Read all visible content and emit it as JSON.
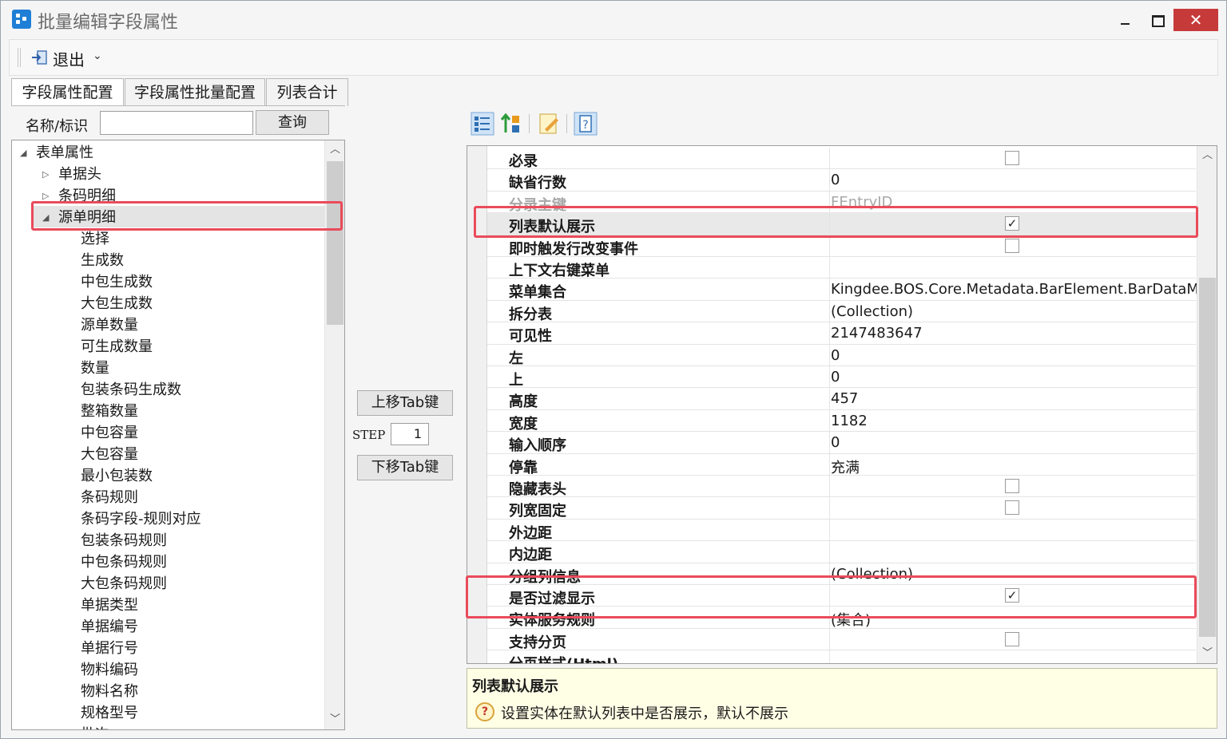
{
  "window": {
    "title": "批量编辑字段属性",
    "close_glyph": "✕"
  },
  "toolbar": {
    "exit_label": "退出",
    "dropdown_glyph": "⌄"
  },
  "tabs": [
    {
      "label": "字段属性配置",
      "active": true
    },
    {
      "label": "字段属性批量配置",
      "active": false
    },
    {
      "label": "列表合计",
      "active": false
    }
  ],
  "search": {
    "label": "名称/标识",
    "value": "",
    "button": "查询"
  },
  "tree": {
    "items": [
      {
        "label": "表单属性",
        "level": 0,
        "twisty": "◢"
      },
      {
        "label": "单据头",
        "level": 1,
        "twisty": "▷"
      },
      {
        "label": "条码明细",
        "level": 1,
        "twisty": "▷"
      },
      {
        "label": "源单明细",
        "level": 1,
        "twisty": "◢",
        "selected": true
      },
      {
        "label": "选择",
        "level": 2
      },
      {
        "label": "生成数",
        "level": 2
      },
      {
        "label": "中包生成数",
        "level": 2
      },
      {
        "label": "大包生成数",
        "level": 2
      },
      {
        "label": "源单数量",
        "level": 2
      },
      {
        "label": "可生成数量",
        "level": 2
      },
      {
        "label": "数量",
        "level": 2
      },
      {
        "label": "包装条码生成数",
        "level": 2
      },
      {
        "label": "整箱数量",
        "level": 2
      },
      {
        "label": "中包容量",
        "level": 2
      },
      {
        "label": "大包容量",
        "level": 2
      },
      {
        "label": "最小包装数",
        "level": 2
      },
      {
        "label": "条码规则",
        "level": 2
      },
      {
        "label": "条码字段-规则对应",
        "level": 2
      },
      {
        "label": "包装条码规则",
        "level": 2
      },
      {
        "label": "中包条码规则",
        "level": 2
      },
      {
        "label": "大包条码规则",
        "level": 2
      },
      {
        "label": "单据类型",
        "level": 2
      },
      {
        "label": "单据编号",
        "level": 2
      },
      {
        "label": "单据行号",
        "level": 2
      },
      {
        "label": "物料编码",
        "level": 2
      },
      {
        "label": "物料名称",
        "level": 2
      },
      {
        "label": "规格型号",
        "level": 2
      },
      {
        "label": "批次",
        "level": 2
      }
    ]
  },
  "middle": {
    "move_up": "上移Tab键",
    "step_label": "STEP",
    "step_value": "1",
    "move_down": "下移Tab键"
  },
  "property_grid": {
    "rows": [
      {
        "name": "必录",
        "type": "checkbox",
        "checked": false
      },
      {
        "name": "缺省行数",
        "value": "0"
      },
      {
        "name": "分录主键",
        "value": "FEntryID",
        "disabled": true
      },
      {
        "name": "列表默认展示",
        "type": "checkbox",
        "checked": true,
        "highlight": true
      },
      {
        "name": "即时触发行改变事件",
        "type": "checkbox",
        "checked": false
      },
      {
        "name": "上下文右键菜单",
        "value": ""
      },
      {
        "name": "菜单集合",
        "value": "Kingdee.BOS.Core.Metadata.BarElement.BarDataMa..."
      },
      {
        "name": "拆分表",
        "value": "(Collection)"
      },
      {
        "name": "可见性",
        "value": "2147483647"
      },
      {
        "name": "左",
        "value": "0"
      },
      {
        "name": "上",
        "value": "0"
      },
      {
        "name": "高度",
        "value": "457"
      },
      {
        "name": "宽度",
        "value": "1182"
      },
      {
        "name": "输入顺序",
        "value": "0"
      },
      {
        "name": "停靠",
        "value": "充满"
      },
      {
        "name": "隐藏表头",
        "type": "checkbox",
        "checked": false
      },
      {
        "name": "列宽固定",
        "type": "checkbox",
        "checked": false
      },
      {
        "name": "外边距",
        "value": ""
      },
      {
        "name": "内边距",
        "value": ""
      },
      {
        "name": "分组列信息",
        "value": "(Collection)"
      },
      {
        "name": "是否过滤显示",
        "type": "checkbox",
        "checked": true
      },
      {
        "name": "实体服务规则",
        "value": "(集合)"
      },
      {
        "name": "支持分页",
        "type": "checkbox",
        "checked": false
      },
      {
        "name": "分页样式(Html)",
        "value": ""
      }
    ],
    "check_glyph": "✓"
  },
  "description": {
    "title": "列表默认展示",
    "text": "设置实体在默认列表中是否展示，默认不展示",
    "icon_glyph": "?"
  },
  "scroll": {
    "up_glyph": "︿",
    "down_glyph": "﹀"
  },
  "colors": {
    "highlight_box": "#ea4b5b",
    "close_button": "#c73a3a",
    "description_bg": "#ffffe6"
  }
}
